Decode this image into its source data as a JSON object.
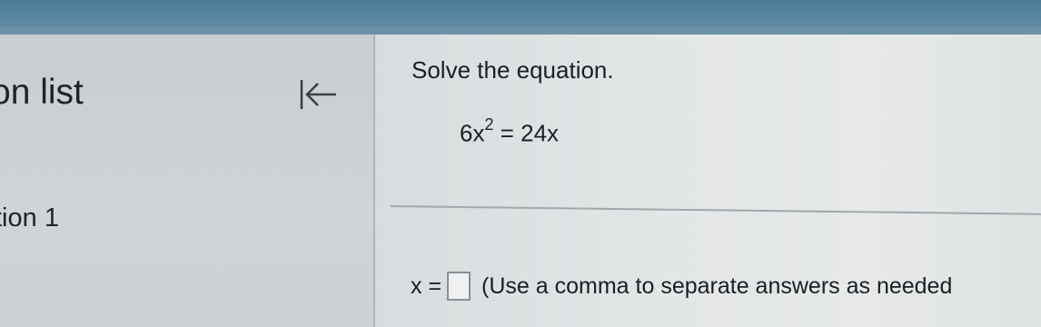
{
  "question_list": {
    "title": "on list",
    "collapse_icon": "collapse-left-arrow-icon",
    "items": [
      {
        "label": "tion 1"
      }
    ]
  },
  "question": {
    "instruction": "Solve the equation.",
    "equation": {
      "left_coefficient": "6x",
      "exponent": "2",
      "right": "= 24x"
    },
    "answer": {
      "variable_label": "x =",
      "value": "",
      "hint": "(Use a comma to separate answers as needed"
    }
  },
  "colors": {
    "top_bar": "#5a87a0",
    "text": "#1c1f22",
    "panel_background": "#d0d4d6",
    "main_background": "#e3e6e7"
  }
}
